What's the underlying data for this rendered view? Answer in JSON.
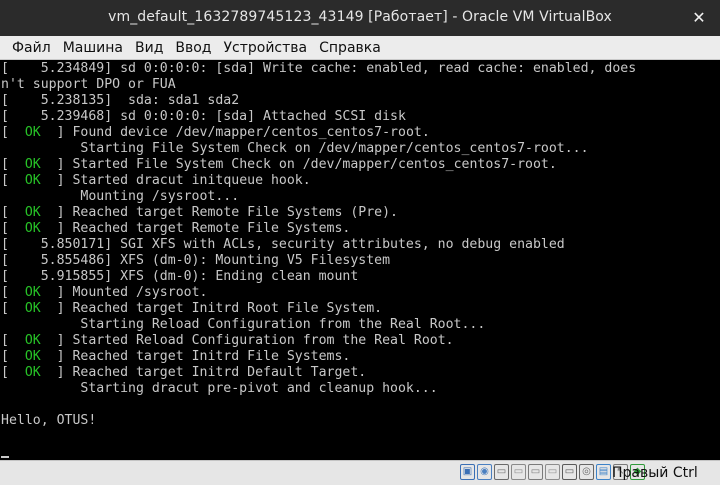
{
  "window": {
    "title": "vm_default_1632789745123_43149 [Работает] - Oracle VM VirtualBox",
    "close_glyph": "✕"
  },
  "menu": {
    "items": [
      "Файл",
      "Машина",
      "Вид",
      "Ввод",
      "Устройства",
      "Справка"
    ]
  },
  "console": {
    "ok_label": "OK",
    "lines": [
      {
        "kind": "plain",
        "text": "[    5.234849] sd 0:0:0:0: [sda] Write cache: enabled, read cache: enabled, does"
      },
      {
        "kind": "plain",
        "text": "n't support DPO or FUA"
      },
      {
        "kind": "plain",
        "text": "[    5.238135]  sda: sda1 sda2"
      },
      {
        "kind": "plain",
        "text": "[    5.239468] sd 0:0:0:0: [sda] Attached SCSI disk"
      },
      {
        "kind": "ok",
        "text": "Found device /dev/mapper/centos_centos7-root."
      },
      {
        "kind": "plain",
        "text": "          Starting File System Check on /dev/mapper/centos_centos7-root..."
      },
      {
        "kind": "ok",
        "text": "Started File System Check on /dev/mapper/centos_centos7-root."
      },
      {
        "kind": "ok",
        "text": "Started dracut initqueue hook."
      },
      {
        "kind": "plain",
        "text": "          Mounting /sysroot..."
      },
      {
        "kind": "ok",
        "text": "Reached target Remote File Systems (Pre)."
      },
      {
        "kind": "ok",
        "text": "Reached target Remote File Systems."
      },
      {
        "kind": "plain",
        "text": "[    5.850171] SGI XFS with ACLs, security attributes, no debug enabled"
      },
      {
        "kind": "plain",
        "text": "[    5.855486] XFS (dm-0): Mounting V5 Filesystem"
      },
      {
        "kind": "plain",
        "text": "[    5.915855] XFS (dm-0): Ending clean mount"
      },
      {
        "kind": "ok",
        "text": "Mounted /sysroot."
      },
      {
        "kind": "ok",
        "text": "Reached target Initrd Root File System."
      },
      {
        "kind": "plain",
        "text": "          Starting Reload Configuration from the Real Root..."
      },
      {
        "kind": "ok",
        "text": "Started Reload Configuration from the Real Root."
      },
      {
        "kind": "ok",
        "text": "Reached target Initrd File Systems."
      },
      {
        "kind": "ok",
        "text": "Reached target Initrd Default Target."
      },
      {
        "kind": "plain",
        "text": "          Starting dracut pre-pivot and cleanup hook..."
      },
      {
        "kind": "plain",
        "text": ""
      },
      {
        "kind": "plain",
        "text": "Hello, OTUS!"
      }
    ]
  },
  "statusbar": {
    "icons": [
      {
        "name": "hard-disk-icon",
        "color": "#3a6fb5"
      },
      {
        "name": "optical-drive-icon",
        "color": "#4a7fc0"
      },
      {
        "name": "audio-icon",
        "color": "#6a6a6a"
      },
      {
        "name": "network-icon",
        "color": "#8a8a8a"
      },
      {
        "name": "usb-icon",
        "color": "#7a7a7a"
      },
      {
        "name": "shared-folders-icon",
        "color": "#8c8c8c"
      },
      {
        "name": "display-icon",
        "color": "#5a5a5a"
      },
      {
        "name": "video-capture-icon",
        "color": "#666666"
      },
      {
        "name": "cpu-icon",
        "color": "#3c82c8"
      },
      {
        "name": "mouse-integration-icon",
        "color": "#7a7a7a"
      },
      {
        "name": "keyboard-capture-icon",
        "color": "#2f9a3a"
      }
    ],
    "host_key": "Правый Ctrl"
  }
}
